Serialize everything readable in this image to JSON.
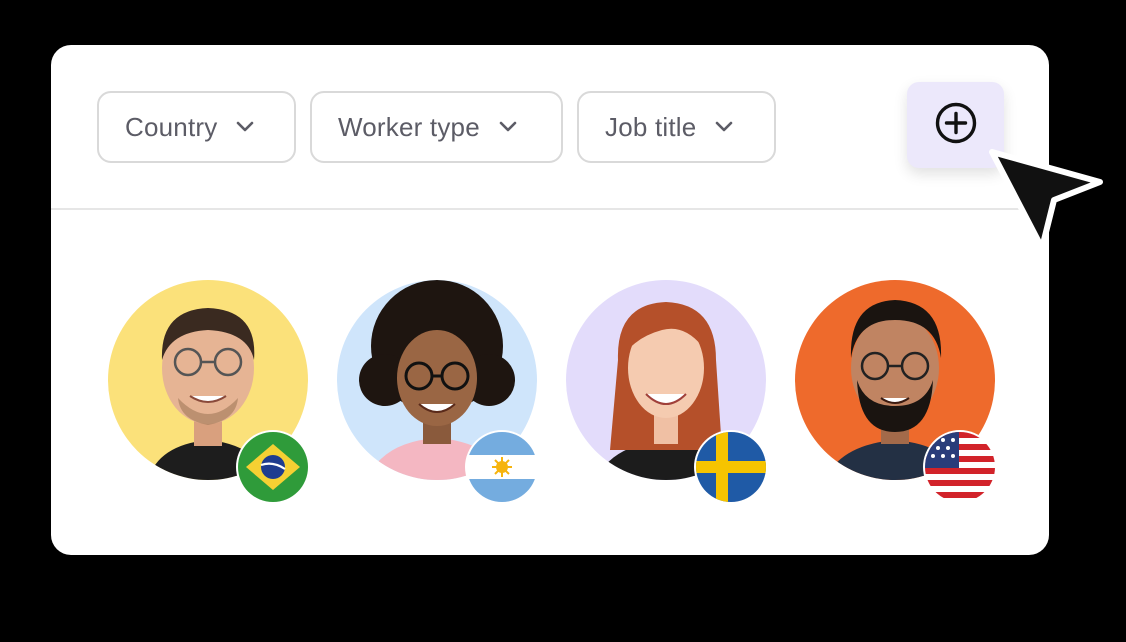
{
  "filters": [
    {
      "label": "Country",
      "icon": "chevron-down-icon"
    },
    {
      "label": "Worker type",
      "icon": "chevron-down-icon"
    },
    {
      "label": "Job title",
      "icon": "chevron-down-icon"
    }
  ],
  "add_button": {
    "icon": "plus-circle-icon"
  },
  "workers": [
    {
      "avatar_bg": "#fbe17a",
      "flag": "brazil-flag-icon"
    },
    {
      "avatar_bg": "#cfe5fb",
      "flag": "argentina-flag-icon"
    },
    {
      "avatar_bg": "#e3dcfb",
      "flag": "sweden-flag-icon"
    },
    {
      "avatar_bg": "#ee6a2c",
      "flag": "usa-flag-icon"
    }
  ],
  "colors": {
    "background": "#000000",
    "card": "#ffffff",
    "filter_border": "#d9d9d9",
    "filter_text": "#5c5c66",
    "add_button_bg": "#ece8fb",
    "divider": "#e6e6e6"
  }
}
